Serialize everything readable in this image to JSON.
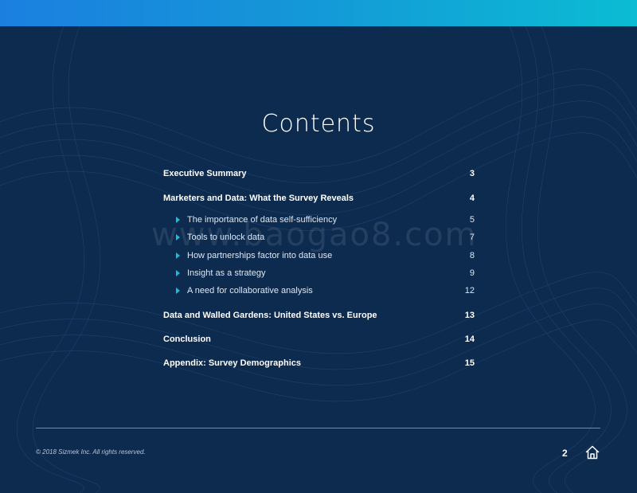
{
  "title": "Contents",
  "watermark": "www.baogao8.com",
  "toc": [
    {
      "level": "main",
      "label": "Executive Summary",
      "page": "3"
    },
    {
      "level": "main",
      "label": "Marketers and Data: What the Survey Reveals",
      "page": "4"
    },
    {
      "level": "sub",
      "label": "The importance of data self-sufficiency",
      "page": "5"
    },
    {
      "level": "sub",
      "label": "Tools to unlock data",
      "page": "7"
    },
    {
      "level": "sub",
      "label": "How partnerships factor into data use",
      "page": "8"
    },
    {
      "level": "sub",
      "label": "Insight as a strategy",
      "page": "9"
    },
    {
      "level": "sub",
      "label": "A need for collaborative analysis",
      "page": "12"
    },
    {
      "level": "main",
      "label": "Data and Walled Gardens: United States vs. Europe",
      "page": "13"
    },
    {
      "level": "main",
      "label": "Conclusion",
      "page": "14"
    },
    {
      "level": "main",
      "label": "Appendix: Survey Demographics",
      "page": "15"
    }
  ],
  "footer": {
    "copyright": "© 2018 Sizmek Inc. All rights reserved.",
    "page_number": "2",
    "home_icon": "home-icon"
  },
  "colors": {
    "background": "#0d2a4f",
    "accent": "#17c1d4",
    "header_gradient_start": "#1b7fe0",
    "header_gradient_end": "#0bbcd3"
  }
}
